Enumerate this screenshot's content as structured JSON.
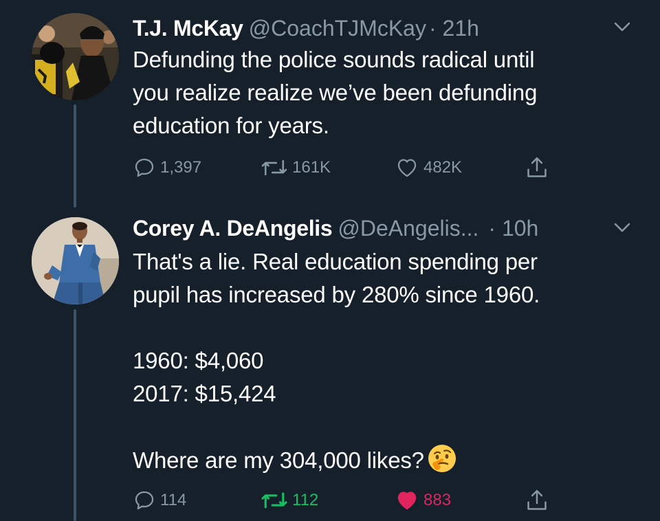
{
  "tweets": [
    {
      "name": "T.J. McKay",
      "handle": "@CoachTJMcKay",
      "time": "· 21h",
      "text": [
        "Defunding the police sounds radical until",
        "you realize realize we’ve been defunding",
        "education for years."
      ],
      "replies": "1,397",
      "retweets": "161K",
      "likes": "482K",
      "retweeted": false,
      "liked": false
    },
    {
      "name": "Corey A. DeAngelis",
      "handle": "@DeAngelis...",
      "time": "· 10h",
      "text": [
        "That's a lie. Real education spending per",
        "pupil has increased by 280% since 1960.",
        "",
        "1960: $4,060",
        "2017: $15,424",
        "",
        "Where are my 304,000 likes?"
      ],
      "emoji": "thinking-face-emoji",
      "replies": "114",
      "retweets": "112",
      "likes": "883",
      "retweeted": true,
      "liked": true
    }
  ],
  "icons": {
    "reply": "reply-bubble-icon",
    "retweet": "retweet-arrows-icon",
    "like": "heart-icon",
    "share": "share-upload-icon",
    "menu": "chevron-down-icon"
  },
  "colors": {
    "background": "#15202b",
    "secondary_text": "#8899a6",
    "thread_line": "#3d5466",
    "retweet_active": "#17bf63",
    "like_active": "#e0245e"
  }
}
